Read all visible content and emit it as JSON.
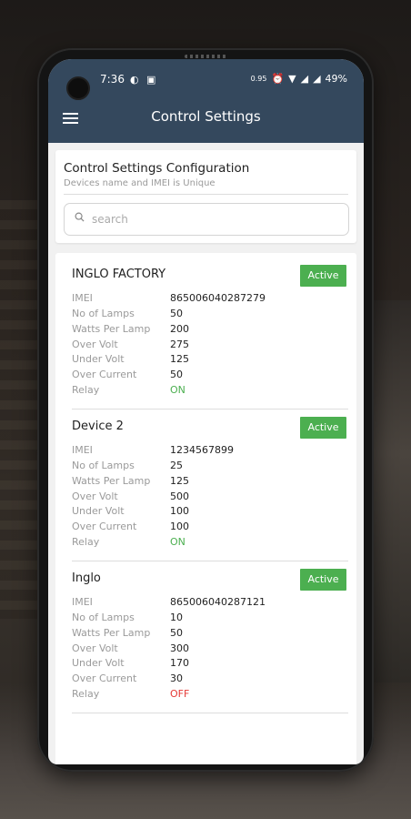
{
  "status_bar": {
    "time": "7:36",
    "net_speed": "0.95",
    "battery": "49%"
  },
  "appbar": {
    "title": "Control Settings"
  },
  "config": {
    "title": "Control Settings Configuration",
    "subtitle": "Devices name and IMEI is Unique",
    "search_placeholder": "search"
  },
  "labels": {
    "imei": "IMEI",
    "lamps": "No of Lamps",
    "watts": "Watts Per Lamp",
    "over_volt": "Over Volt",
    "under_volt": "Under Volt",
    "over_current": "Over Current",
    "relay": "Relay"
  },
  "devices": [
    {
      "name": "INGLO FACTORY",
      "status": "Active",
      "imei": "865006040287279",
      "lamps": "50",
      "watts": "200",
      "over_volt": "275",
      "under_volt": "125",
      "over_current": "50",
      "relay": "ON"
    },
    {
      "name": "Device 2",
      "status": "Active",
      "imei": "1234567899",
      "lamps": "25",
      "watts": "125",
      "over_volt": "500",
      "under_volt": "100",
      "over_current": "100",
      "relay": "ON"
    },
    {
      "name": "Inglo",
      "status": "Active",
      "imei": "865006040287121",
      "lamps": "10",
      "watts": "50",
      "over_volt": "300",
      "under_volt": "170",
      "over_current": "30",
      "relay": "OFF"
    }
  ],
  "colors": {
    "appbar": "#34485d",
    "active": "#4caf50",
    "relay_on": "#4caf50",
    "relay_off": "#e53935"
  }
}
